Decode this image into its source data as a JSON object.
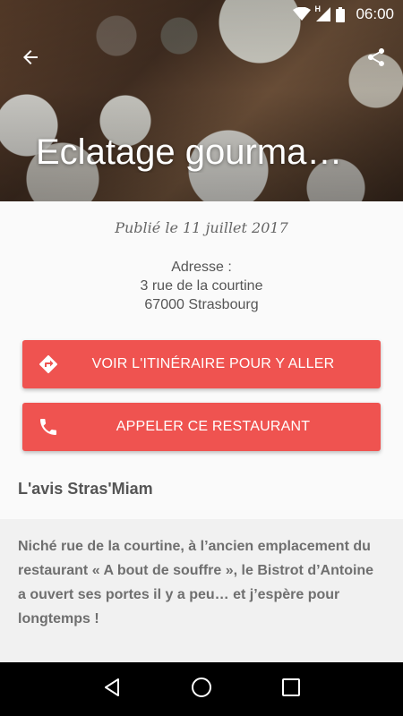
{
  "status_bar": {
    "time": "06:00",
    "network_label": "H",
    "icons": [
      "wifi-icon",
      "signal-icon",
      "battery-icon"
    ]
  },
  "app_bar": {
    "back_icon": "arrow-back-icon",
    "share_icon": "share-icon"
  },
  "hero": {
    "title": "Eclatage gourma…"
  },
  "details": {
    "published": "Publié le 11 juillet 2017",
    "address_label": "Adresse :",
    "address_line1": "3 rue de la courtine",
    "address_line2": "67000 Strasbourg"
  },
  "buttons": {
    "route_label": "VOIR L'ITINÉRAIRE POUR Y ALLER",
    "route_icon": "directions-icon",
    "call_label": "APPELER CE RESTAURANT",
    "call_icon": "phone-icon"
  },
  "review": {
    "title": "L'avis Stras'Miam",
    "text": "Niché rue de la courtine, à l’ancien emplacement du restaurant « A bout de souffre », le Bistrot d’Antoine a ouvert ses portes il y a peu… et j’espère pour longtemps !"
  },
  "nav": {
    "icons": [
      "back-triangle-icon",
      "home-circle-icon",
      "recents-square-icon"
    ]
  },
  "colors": {
    "accent": "#ef5350",
    "review_bg": "#f1f1f1",
    "nav_bg": "#000000"
  }
}
